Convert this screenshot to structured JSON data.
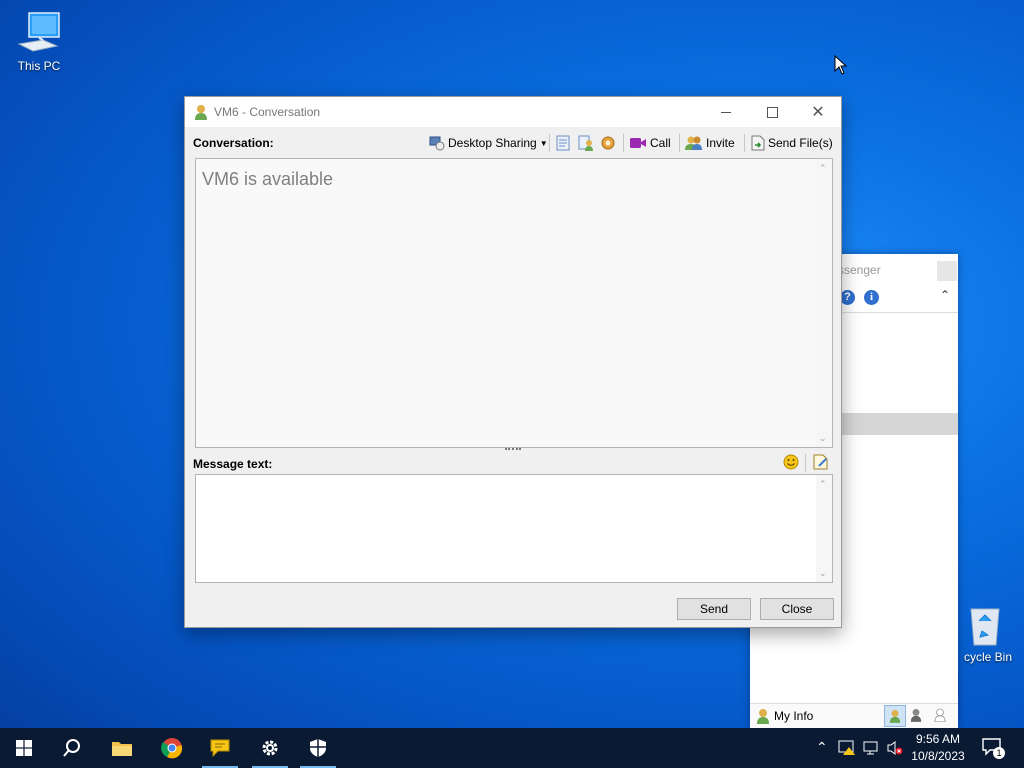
{
  "desktop": {
    "this_pc_label": "This PC",
    "recycle_bin_label": "cycle Bin"
  },
  "messenger": {
    "title_partial": "ssenger",
    "my_info_label": "My Info"
  },
  "conversation": {
    "title": "VM6 - Conversation",
    "conversation_label": "Conversation:",
    "toolbar": {
      "desktop_sharing": "Desktop Sharing",
      "call": "Call",
      "invite": "Invite",
      "send_files": "Send File(s)"
    },
    "status_text": "VM6 is available",
    "message_label": "Message text:",
    "message_value": "",
    "send_button": "Send",
    "close_button": "Close"
  },
  "taskbar": {
    "time": "9:56 AM",
    "date": "10/8/2023",
    "notification_count": "1"
  }
}
